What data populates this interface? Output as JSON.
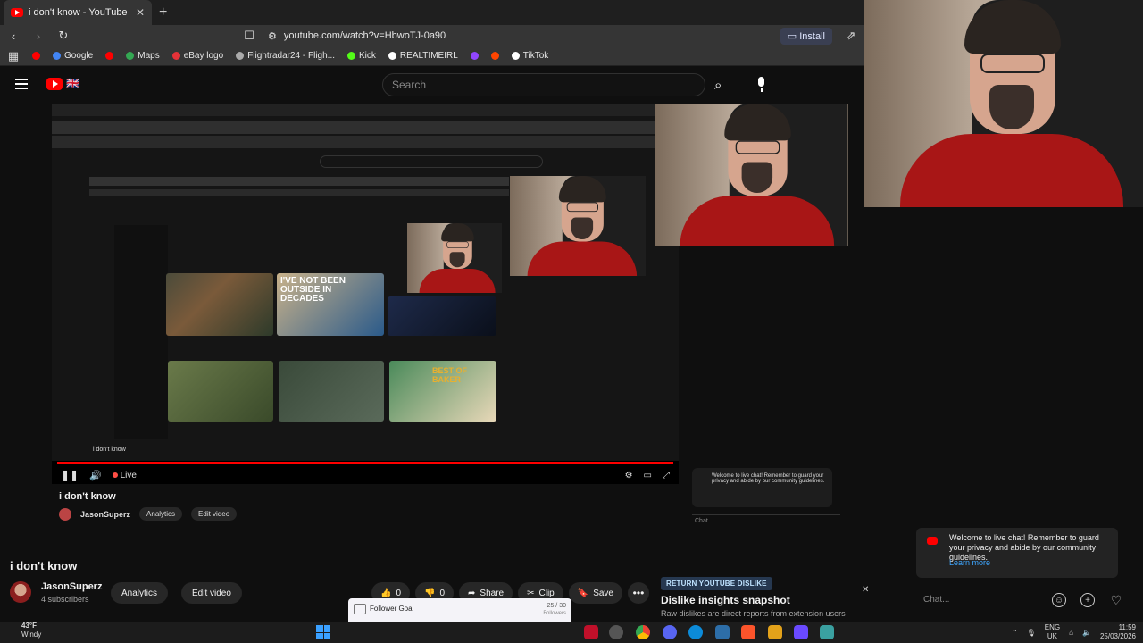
{
  "browser": {
    "tab_title": "i don't know - YouTube",
    "new_tab": "+",
    "url": "youtube.com/watch?v=HbwoTJ-0a90",
    "install_label": "Install",
    "bookmarks": [
      {
        "label": "",
        "color": "#ff0000"
      },
      {
        "label": "Google",
        "color": "#4285f4"
      },
      {
        "label": "",
        "color": "#ff0000"
      },
      {
        "label": "Maps",
        "color": "#34a853"
      },
      {
        "label": "eBay logo",
        "color": "#e53238"
      },
      {
        "label": "Flightradar24 - Fligh...",
        "color": "#aaaaaa"
      },
      {
        "label": "Kick",
        "color": "#53fc18"
      },
      {
        "label": "REALTIMEIRL",
        "color": "#ffffff"
      },
      {
        "label": "",
        "color": "#9146ff"
      },
      {
        "label": "",
        "color": "#ff4500"
      },
      {
        "label": "TikTok",
        "color": "#ffffff"
      }
    ]
  },
  "youtube": {
    "brand_suffix": "🇬🇧",
    "search_placeholder": "Search",
    "video_title": "i don't know",
    "channel": "JasonSuperz",
    "subscribers": "4 subscribers",
    "analytics_label": "Analytics",
    "edit_label": "Edit video",
    "like_count": "0",
    "dislike_count": "0",
    "share_label": "Share",
    "clip_label": "Clip",
    "save_label": "Save",
    "live_label": "Live"
  },
  "follower_goal": {
    "label": "Follower Goal",
    "count": "25 / 30",
    "unit": "Followers",
    "progress": 0.8333
  },
  "return_dislike": {
    "tag": "RETURN YOUTUBE DISLIKE",
    "title": "Dislike insights snapshot",
    "subtitle": "Raw dislikes are direct reports from extension users"
  },
  "chat": {
    "welcome": "Welcome to live chat! Remember to guard your privacy and abide by our community guidelines.",
    "learn_more": "Learn more",
    "placeholder": "Chat..."
  },
  "nested": {
    "thumb1_text": "I'VE NOT BEEN OUTSIDE IN DECADES",
    "thumb2_text": "BEST OF BAKER",
    "title": "i don't know",
    "channel": "JasonSuperz"
  },
  "taskbar": {
    "temp": "43°F",
    "weather": "Windy",
    "lang1": "ENG",
    "lang2": "UK",
    "time": "11:59",
    "date": "25/03/2026"
  },
  "colors": {
    "accent": "#ff0000",
    "link": "#3ea6ff",
    "goal_purple": "#9147ff"
  }
}
